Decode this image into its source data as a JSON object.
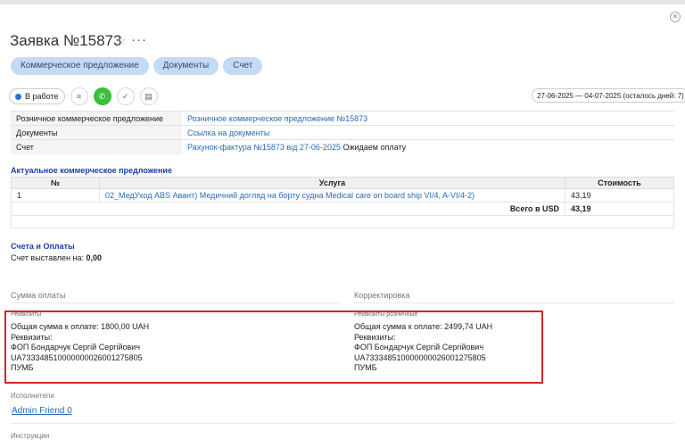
{
  "header": {
    "title": "Заявка №15873",
    "more_label": "···"
  },
  "tabs": [
    {
      "label": "Коммерческое предложение"
    },
    {
      "label": "Документы"
    },
    {
      "label": "Счет"
    }
  ],
  "toolbar": {
    "status_label": "В работе",
    "status_color": "#2a72d8",
    "date_range": "27-06-2025 — 04-07-2025  (осталось дней: 7)"
  },
  "info_rows": [
    {
      "label": "Розничное коммерческое предложение",
      "value": "Розничное коммерческое предложение №15873",
      "link": true,
      "suffix": ""
    },
    {
      "label": "Документы",
      "value": "Ссылка на документы",
      "link": true,
      "suffix": ""
    },
    {
      "label": "Счет",
      "value": "Рахунок-фактура №15873 від 27-06-2025",
      "link": true,
      "suffix": " Ожидаем оплату"
    }
  ],
  "offer": {
    "title": "Актуальное коммерческое предложение",
    "headers": [
      "№",
      "Услуга",
      "Стоимость"
    ],
    "rows": [
      {
        "num": "1",
        "service": "02_МедУход ABS Авант) Медичний догляд на борту судна Medical care on board ship VI/4, A-VI/4-2)",
        "price": "43,19"
      }
    ],
    "total_label": "Всего в USD",
    "total_value": "43,19"
  },
  "payments": {
    "title": "Счета и Оплаты",
    "invoiced_label": "Счет выставлен на:",
    "invoiced_value": "0,00"
  },
  "sum_label": "Сумма оплаты",
  "correction_label": "Корректировка",
  "requisites_left": {
    "caption": "Реквизиты",
    "lines": [
      "Общая сумма к оплате: 1800,00 UAH",
      "Реквизиты:",
      "ФОП Бондарчук Сергій Сергійович",
      "UA733348510000000026001275805",
      "ПУМБ"
    ]
  },
  "requisites_right": {
    "caption": "Реквизиты розничные",
    "lines": [
      "Общая сумма к оплате: 2499,74 UAH",
      "Реквизиты:",
      "ФОП Бондарчук Сергій Сергійович",
      "UA733348510000000026001275805",
      "ПУМБ"
    ]
  },
  "executors": {
    "label": "Исполнители",
    "value": "Admin Friend 0"
  },
  "instructions": {
    "label": "Инструкции"
  },
  "colors": {
    "accent": "#2a6ab7",
    "section_title": "#1b3fa8",
    "highlight_box": "#d9232b",
    "pill_bg": "#c4dbf4"
  }
}
